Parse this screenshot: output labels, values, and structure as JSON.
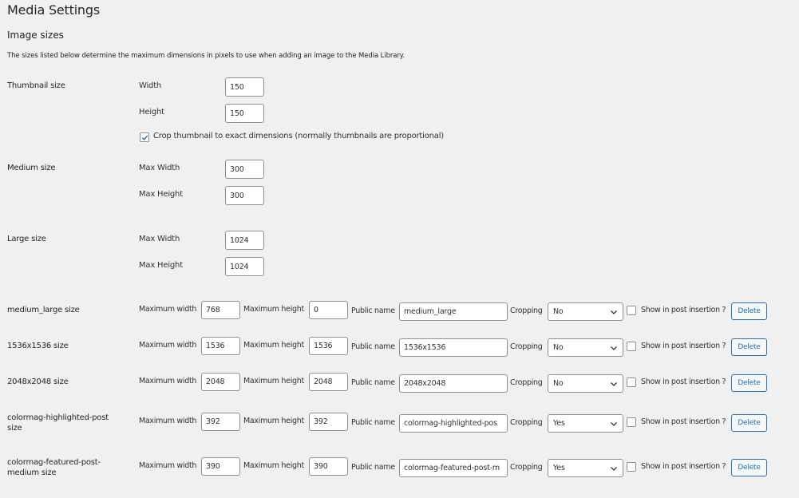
{
  "page_title": "Media Settings",
  "section_title": "Image sizes",
  "description": "The sizes listed below determine the maximum dimensions in pixels to use when adding an image to the Media Library.",
  "thumbnail": {
    "label": "Thumbnail size",
    "width_label": "Width",
    "width_value": "150",
    "height_label": "Height",
    "height_value": "150",
    "crop_checked": true,
    "crop_label": "Crop thumbnail to exact dimensions (normally thumbnails are proportional)"
  },
  "medium": {
    "label": "Medium size",
    "width_label": "Max Width",
    "width_value": "300",
    "height_label": "Max Height",
    "height_value": "300"
  },
  "large": {
    "label": "Large size",
    "width_label": "Max Width",
    "width_value": "1024",
    "height_label": "Max Height",
    "height_value": "1024"
  },
  "labels": {
    "max_width": "Maximum width",
    "max_height": "Maximum height",
    "public_name": "Public name",
    "cropping": "Cropping",
    "show_insertion": "Show in post insertion ?",
    "delete": "Delete"
  },
  "custom_sizes": [
    {
      "label": "medium_large size",
      "width": "768",
      "height": "0",
      "public_name": "medium_large",
      "cropping": "No",
      "show": false
    },
    {
      "label": "1536x1536 size",
      "width": "1536",
      "height": "1536",
      "public_name": "1536x1536",
      "cropping": "No",
      "show": false
    },
    {
      "label": "2048x2048 size",
      "width": "2048",
      "height": "2048",
      "public_name": "2048x2048",
      "cropping": "No",
      "show": false
    },
    {
      "label": "colormag-highlighted-post size",
      "label_line1": "colormag-highlighted-post",
      "label_line2": "size",
      "width": "392",
      "height": "392",
      "public_name": "colormag-highlighted-pos",
      "cropping": "Yes",
      "show": false
    },
    {
      "label": "colormag-featured-post-medium size",
      "label_line1": "colormag-featured-post-",
      "label_line2": "medium size",
      "width": "390",
      "height": "390",
      "public_name": "colormag-featured-post-m",
      "cropping": "Yes",
      "show": false
    }
  ],
  "colors": {
    "background": "#f0f0f1",
    "accent": "#2271b1",
    "border": "#8c8f94"
  }
}
